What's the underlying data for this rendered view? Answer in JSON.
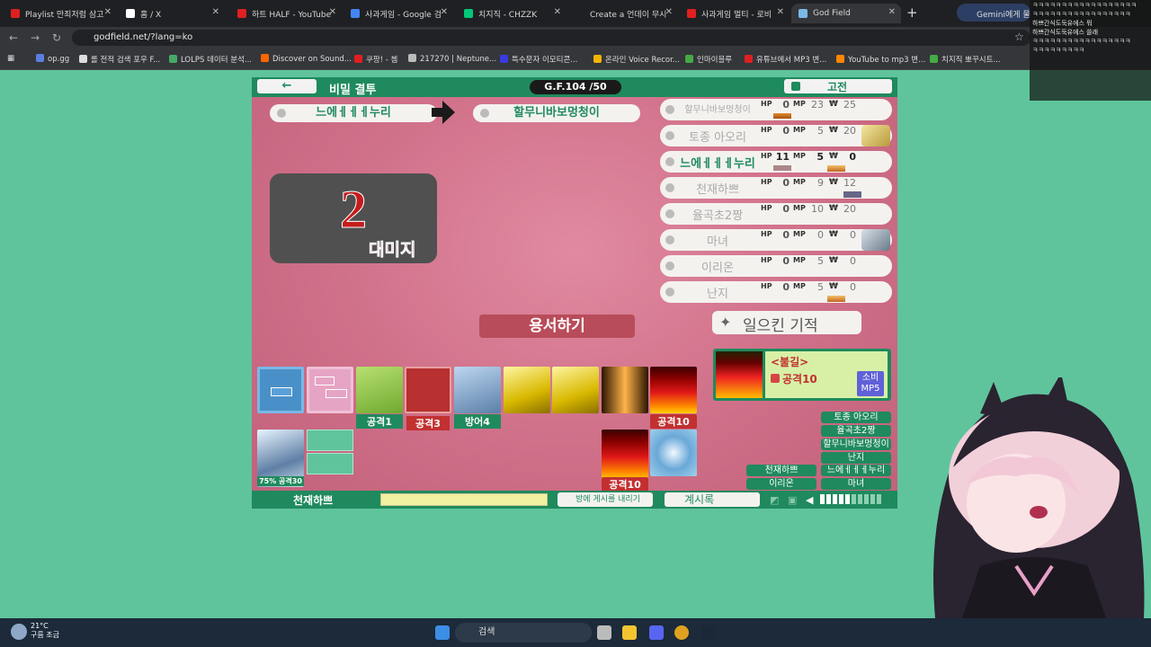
{
  "browser": {
    "tabs": [
      {
        "label": "Playlist 만죄저럼 삼고",
        "color": "#e02020"
      },
      {
        "label": "홈 / X",
        "color": "#ffffff"
      },
      {
        "label": "하트 HALF - YouTube",
        "color": "#e02020"
      },
      {
        "label": "사과게임 - Google 검",
        "color": "#4285f4"
      },
      {
        "label": "치지직 - CHZZK",
        "color": "#00c878"
      },
      {
        "label": "Create a 언데이 무시",
        "color": "#2b2b2b"
      },
      {
        "label": "사과게임 멀티 - 로비",
        "color": "#e02020"
      },
      {
        "label": "God Field",
        "color": "#7ab8e6"
      }
    ],
    "gemini": "Gemini에게 물어",
    "url": "godfield.net/?lang=ko",
    "bookmarks": [
      "op.gg",
      "롤 전적 검색 포우 F...",
      "LOLPS 데이터 분석...",
      "Discover on Sound...",
      "쿠팡! - 쳄",
      "217270 | Neptune...",
      "특수문자 이모티콘...",
      "온라인 Voice Recor...",
      "인마이블루",
      "유튜브에서 MP3 변...",
      "YouTube to mp3 변...",
      "치지직 뽀꾸시트..."
    ]
  },
  "chat_overlay": [
    "ㅋㅋㅋㅋㅋㅋㅋㅋㅋㅋㅋㅋㅋㅋㅋㅋㅋㅋ",
    "ㅋㅋㅋㅋㅋㅋㅋㅋㅋㅋㅋㅋㅋㅋㅋㅋㅋ",
    "하쁘간식도둑유에스 뭐",
    "하쁘간식도둑유에스 쓸래",
    "ㅋㅋㅋㅋㅋㅋㅋㅋㅋㅋㅋㅋㅋㅋㅋㅋㅋ",
    "ㅋㅋㅋㅋㅋㅋㅋㅋㅋ"
  ],
  "game": {
    "back_label": "←",
    "mode_title": "비밀 결투",
    "gf_counter": "G.F.104 /50",
    "classic_label": "고전",
    "attacker": "느에ㅔㅔㅔ누리",
    "target": "할무니바보멍청이",
    "damage_value": "2",
    "damage_label": "대미지",
    "players": [
      {
        "name": "할무니바보멍청이",
        "hp": "0",
        "mp": "23",
        "money": "25",
        "me": false
      },
      {
        "name": "토종 아오리",
        "hp": "0",
        "mp": "5",
        "money": "20",
        "me": false
      },
      {
        "name": "느에ㅔㅔㅔ누리",
        "hp": "11",
        "mp": "5",
        "money": "0",
        "me": true
      },
      {
        "name": "천재하쁘",
        "hp": "0",
        "mp": "9",
        "money": "12",
        "me": false
      },
      {
        "name": "율곡초2짱",
        "hp": "0",
        "mp": "10",
        "money": "20",
        "me": false
      },
      {
        "name": "마녀",
        "hp": "0",
        "mp": "0",
        "money": "0",
        "me": false
      },
      {
        "name": "이리온",
        "hp": "0",
        "mp": "5",
        "money": "0",
        "me": false
      },
      {
        "name": "난지",
        "hp": "0",
        "mp": "5",
        "money": "0",
        "me": false
      }
    ],
    "hp_label": "HP",
    "mp_label": "MP",
    "money_label": "₩",
    "forgive_label": "용서하기",
    "miracle_label": "일으킨 기적",
    "info": {
      "name": "<불길>",
      "attack": "공격10",
      "cost_line1": "소비",
      "cost_line2": "MP5"
    },
    "hand": [
      {
        "label": ""
      },
      {
        "label": ""
      },
      {
        "label": "공격1"
      },
      {
        "label": "공격3"
      },
      {
        "label": "방어4"
      },
      {
        "label": ""
      },
      {
        "label": ""
      },
      {
        "label": ""
      },
      {
        "label": "공격10"
      }
    ],
    "second_row": [
      {
        "label": "75% 공격30"
      },
      {
        "label": "공격10"
      }
    ],
    "name_buttons_right": [
      "토종 아오리",
      "율곡초2짱",
      "할무니바보멍청이",
      "난지",
      "느에ㅔㅔㅔ누리",
      "마녀"
    ],
    "name_buttons_left": [
      "천재하쁘",
      "이리온"
    ],
    "my_name": "천재하쁘",
    "post_label": "방에 게시를 내리기",
    "log_label": "계시록"
  },
  "taskbar": {
    "temp": "21°C",
    "weather": "구름 조금",
    "search": "검색"
  }
}
